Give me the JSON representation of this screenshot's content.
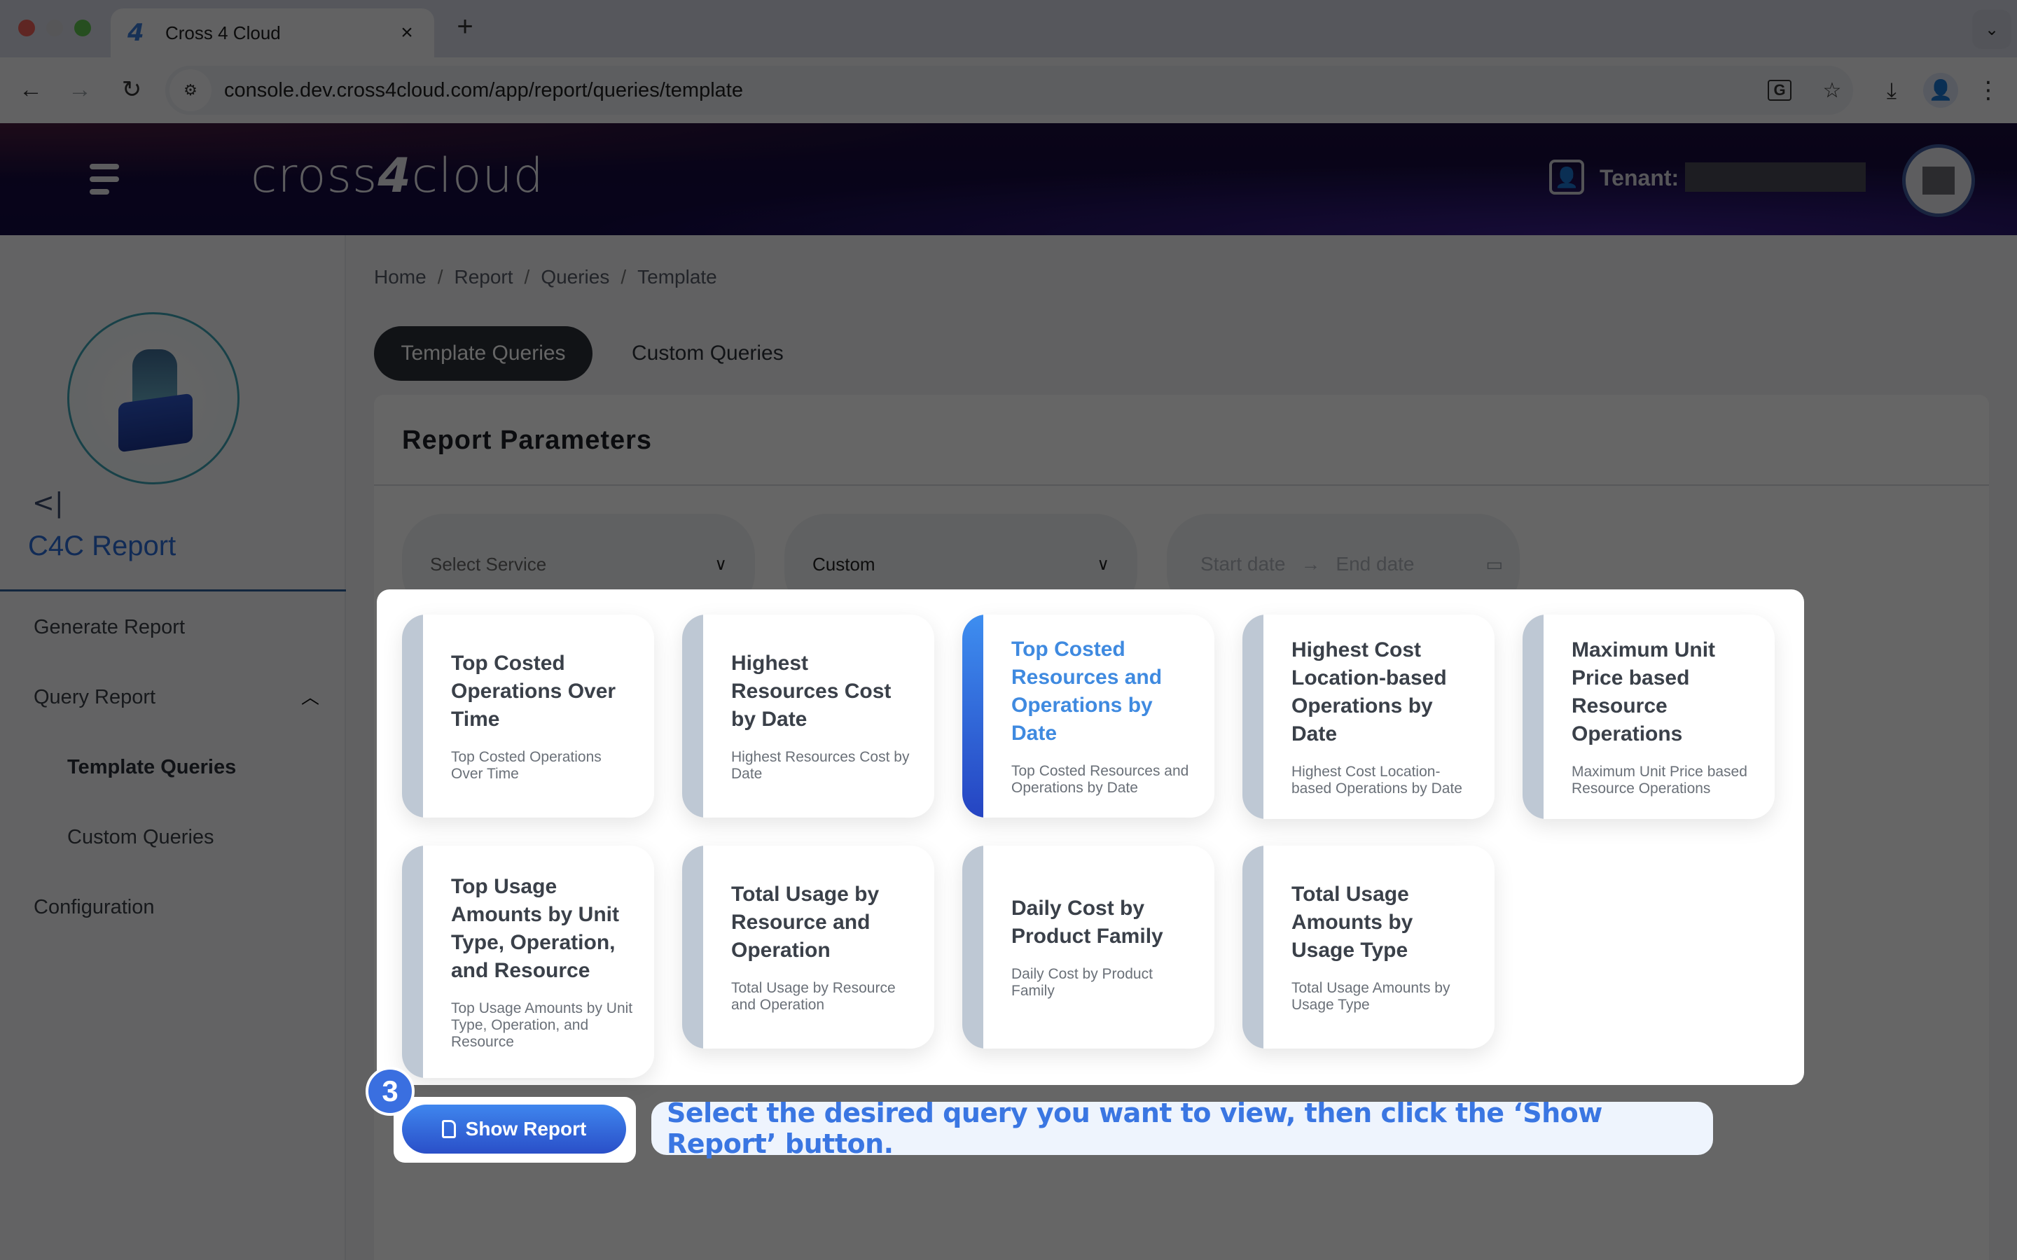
{
  "browser": {
    "tab_title": "Cross 4 Cloud",
    "favicon_glyph": "4",
    "close_glyph": "×",
    "new_tab_glyph": "+",
    "tab_list_glyph": "⌄",
    "url": "console.dev.cross4cloud.com/app/report/queries/template",
    "icons": {
      "back": "←",
      "forward": "→",
      "reload": "↻",
      "site_info": "⚙",
      "translate": "G",
      "bookmark": "☆",
      "download": "⤓",
      "profile": "👤",
      "menu": "⋮"
    }
  },
  "header": {
    "brand_prefix": "cross",
    "brand_digit": "4",
    "brand_suffix": "cloud",
    "tenant_label": "Tenant:",
    "tenant_icon": "👤"
  },
  "sidebar": {
    "collapse_glyph": "<|",
    "title": "C4C Report",
    "items": [
      {
        "label": "Generate Report"
      },
      {
        "label": "Query Report",
        "expanded": true,
        "chevron": "︿"
      },
      {
        "label": "Template Queries",
        "active": true
      },
      {
        "label": "Custom Queries"
      },
      {
        "label": "Configuration"
      }
    ]
  },
  "main": {
    "breadcrumb": [
      "Home",
      "Report",
      "Queries",
      "Template"
    ],
    "breadcrumb_sep": "/",
    "tabs": [
      {
        "label": "Template Queries",
        "active": true
      },
      {
        "label": "Custom Queries",
        "active": false
      }
    ],
    "params_title": "Report Parameters",
    "service_select": {
      "placeholder": "Select Service",
      "chevron": "∨"
    },
    "period_select": {
      "value": "Custom",
      "chevron": "∨"
    },
    "date_range": {
      "start_placeholder": "Start date",
      "arrow": "→",
      "end_placeholder": "End date",
      "calendar_icon": "▭"
    }
  },
  "queries": [
    {
      "title": "Top Costed Operations Over Time",
      "desc": "Top Costed Operations Over Time",
      "selected": false
    },
    {
      "title": "Highest Resources Cost by Date",
      "desc": "Highest Resources Cost by Date",
      "selected": false
    },
    {
      "title": "Top Costed Resources and Operations by Date",
      "desc": "Top Costed Resources and Operations by Date",
      "selected": true
    },
    {
      "title": "Highest Cost Location-based Operations by Date",
      "desc": "Highest Cost Location-based Operations by Date",
      "selected": false
    },
    {
      "title": "Maximum Unit Price based Resource Operations",
      "desc": "Maximum Unit Price based Resource Operations",
      "selected": false
    },
    {
      "title": "Top Usage Amounts by Unit Type, Operation, and Resource",
      "desc": "Top Usage Amounts by Unit Type, Operation, and Resource",
      "selected": false
    },
    {
      "title": "Total Usage by Resource and Operation",
      "desc": "Total Usage by Resource and Operation",
      "selected": false
    },
    {
      "title": "Daily Cost by Product Family",
      "desc": "Daily Cost by Product Family",
      "selected": false
    },
    {
      "title": "Total Usage Amounts by Usage Type",
      "desc": "Total Usage Amounts by Usage Type",
      "selected": false
    }
  ],
  "action": {
    "show_report_label": "Show Report",
    "step_number": "3",
    "callout_text": "Select the desired query you want to view, then click the ‘Show Report’ button."
  },
  "colors": {
    "accent": "#3a76e2",
    "selected_title": "#3f8ae0",
    "card_bar": "#bec8d4",
    "header_bg": "#150b40"
  }
}
